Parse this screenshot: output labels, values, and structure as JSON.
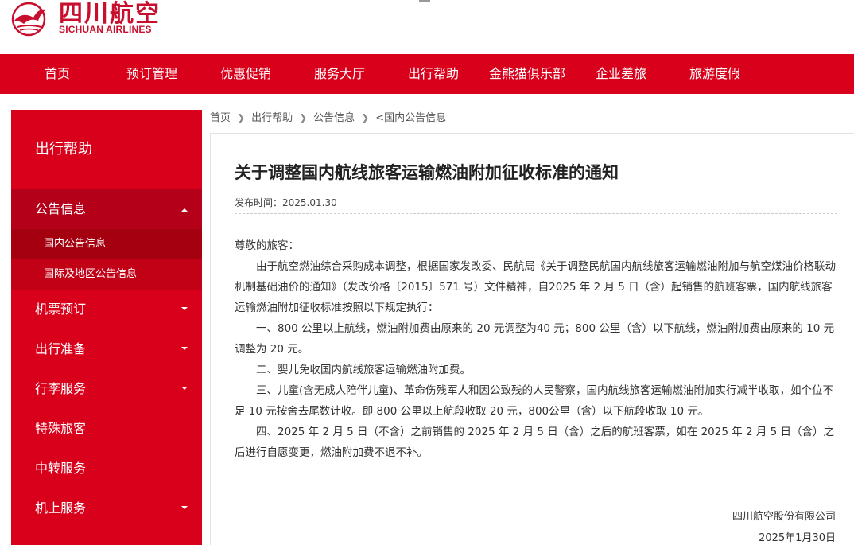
{
  "brand": {
    "name_cn": "四川航空",
    "name_en": "SICHUAN AIRLINES",
    "color": "#c8102e"
  },
  "nav": {
    "items": [
      {
        "label": "首页"
      },
      {
        "label": "预订管理"
      },
      {
        "label": "优惠促销"
      },
      {
        "label": "服务大厅"
      },
      {
        "label": "出行帮助"
      },
      {
        "label": "金熊猫俱乐部"
      },
      {
        "label": "企业差旅"
      },
      {
        "label": "旅游度假"
      }
    ],
    "color": "#d8001b"
  },
  "sidebar": {
    "title": "出行帮助",
    "groups": [
      {
        "label": "公告信息",
        "expanded": true,
        "icon": "chevron-up-icon"
      },
      {
        "label": "机票预订",
        "icon": "chevron-down-icon"
      },
      {
        "label": "出行准备",
        "icon": "chevron-down-icon"
      },
      {
        "label": "行李服务",
        "icon": "chevron-down-icon"
      },
      {
        "label": "特殊旅客"
      },
      {
        "label": "中转服务"
      },
      {
        "label": "机上服务",
        "icon": "chevron-down-icon"
      }
    ],
    "sub_items": [
      {
        "label": "国内公告信息",
        "selected": true
      },
      {
        "label": "国际及地区公告信息"
      }
    ]
  },
  "breadcrumb": [
    "首页",
    "出行帮助",
    "公告信息",
    "<国内公告信息"
  ],
  "article": {
    "title": "关于调整国内航线旅客运输燃油附加征收标准的通知",
    "publish_time": "发布时间：2025.01.30",
    "greeting": "尊敬的旅客：",
    "paragraphs": [
      "由于航空燃油综合采购成本调整，根据国家发改委、民航局《关于调整民航国内航线旅客运输燃油附加与航空煤油价格联动机制基础油价的通知》（发改价格〔2015〕571 号）文件精神，自2025 年 2 月 5 日（含）起销售的航班客票，国内航线旅客运输燃油附加征收标准按照以下规定执行：",
      "一、800 公里以上航线，燃油附加费由原来的 20 元调整为40 元；800 公里（含）以下航线，燃油附加费由原来的 10 元调整为 20 元。",
      "二、婴儿免收国内航线旅客运输燃油附加费。",
      "三、儿童(含无成人陪伴儿童)、革命伤残军人和因公致残的人民警察，国内航线旅客运输燃油附加实行减半收取，如个位不足 10 元按舍去尾数计收。即 800 公里以上航段收取 20 元，800公里（含）以下航段收取 10 元。",
      "四、2025 年 2 月 5 日（不含）之前销售的 2025 年 2 月 5 日（含）之后的航班客票，如在 2025 年 2 月 5 日（含）之后进行自愿变更，燃油附加费不退不补。"
    ],
    "signature": "四川航空股份有限公司",
    "date": "2025年1月30日"
  }
}
